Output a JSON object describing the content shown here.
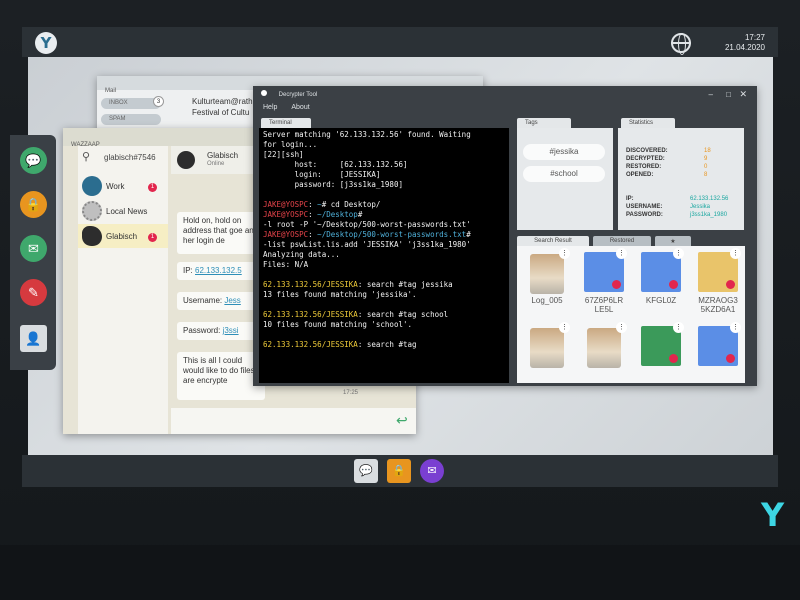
{
  "clock": {
    "time": "17:27",
    "date": "21.04.2020"
  },
  "mail": {
    "title": "Mail",
    "inbox_label": "INBOX",
    "inbox_count": "3",
    "spam_label": "SPAM",
    "from": "Kulturteam@rath",
    "subject": "Festival of Cultu"
  },
  "wazzaap": {
    "title": "WAZZAAP",
    "search_value": "glabisch#7546",
    "contacts": [
      {
        "name": "Work",
        "badge": "1"
      },
      {
        "name": "Local News",
        "badge": ""
      },
      {
        "name": "Glabisch",
        "badge": "1"
      }
    ],
    "chat_name": "Glabisch",
    "chat_status": "Online",
    "messages": [
      "Hold on, hold on address that goe and her login de",
      "IP: ",
      "Username: ",
      "Password: ",
      "This is all I could would like to do files are encrypte"
    ],
    "ip_value": "62.133.132.5",
    "username_value": "Jess",
    "password_value": "j3ssi",
    "time": "17:25"
  },
  "decrypter": {
    "title": "Decrypter Tool",
    "menu": [
      "Help",
      "About"
    ],
    "terminal_tab": "Terminal",
    "tags_tab": "Tags",
    "stats_tab": "Statistics",
    "tags": [
      "#jessika",
      "#school"
    ],
    "stats": [
      {
        "label": "DISCOVERED:",
        "value": "18"
      },
      {
        "label": "DECRYPTED:",
        "value": "9"
      },
      {
        "label": "RESTORED:",
        "value": "0"
      },
      {
        "label": "OPENED:",
        "value": "8"
      }
    ],
    "ip_label": "IP:",
    "ip_value": "62.133.132.56",
    "username_label": "USERNAME:",
    "username_value": "Jessika",
    "password_label": "PASSWORD:",
    "password_value": "j3ss1ka_1980",
    "result_tabs": [
      "Search Result",
      "Restored",
      "★"
    ],
    "files": [
      {
        "name": "Log_005",
        "kind": "photo"
      },
      {
        "name": "67Z6P6LR\nLE5L",
        "kind": "blue"
      },
      {
        "name": "KFGL0Z",
        "kind": "blue"
      },
      {
        "name": "MZRAOG3\n5KZD6A1",
        "kind": "yellow"
      },
      {
        "name": "",
        "kind": "photo"
      },
      {
        "name": "",
        "kind": "photo"
      },
      {
        "name": "",
        "kind": "green"
      },
      {
        "name": "",
        "kind": "blue"
      }
    ],
    "terminal": [
      {
        "t": "Server matching '62.133.132.56' found. Waiting"
      },
      {
        "t": "for login..."
      },
      {
        "t": "[22][ssh]"
      },
      {
        "t": "       host:     [62.133.132.56]"
      },
      {
        "t": "       login:    [JESSIKA]"
      },
      {
        "t": "       password: [j3ss1ka_1980]"
      },
      {
        "t": ""
      },
      {
        "p": "JAKE@YOSPC",
        "a": " ~",
        "c": "# cd Desktop/"
      },
      {
        "p": "JAKE@YOSPC",
        "a": " ~/Desktop",
        "c": "#"
      },
      {
        "t": "-l root -P '~/Desktop/500-worst-passwords.txt'"
      },
      {
        "p": "JAKE@YOSPC",
        "a": " ~/Desktop/500-worst-passwords.txt",
        "c": "#"
      },
      {
        "t": "-list pswList.lis.add 'JESSIKA' 'j3ss1ka_1980'"
      },
      {
        "t": "Analyzing data..."
      },
      {
        "t": "Files: N/A"
      },
      {
        "t": ""
      },
      {
        "p": "62.133.132.56/JESSIKA",
        "a": "",
        "c": ": search #tag jessika"
      },
      {
        "t": "13 files found matching 'jessika'."
      },
      {
        "t": ""
      },
      {
        "p": "62.133.132.56/JESSIKA",
        "a": "",
        "c": ": search #tag school"
      },
      {
        "t": "10 files found matching 'school'."
      },
      {
        "t": ""
      },
      {
        "p": "62.133.132.56/JESSIKA",
        "a": "",
        "c": ": search #tag"
      }
    ]
  },
  "icons": [
    "logo",
    "globe",
    "chat",
    "lock",
    "mail",
    "note",
    "contact"
  ],
  "colors": {
    "accent": "#3dd6e4",
    "badge": "#e2264d",
    "terminal_prompt": "#f0cc3a"
  }
}
